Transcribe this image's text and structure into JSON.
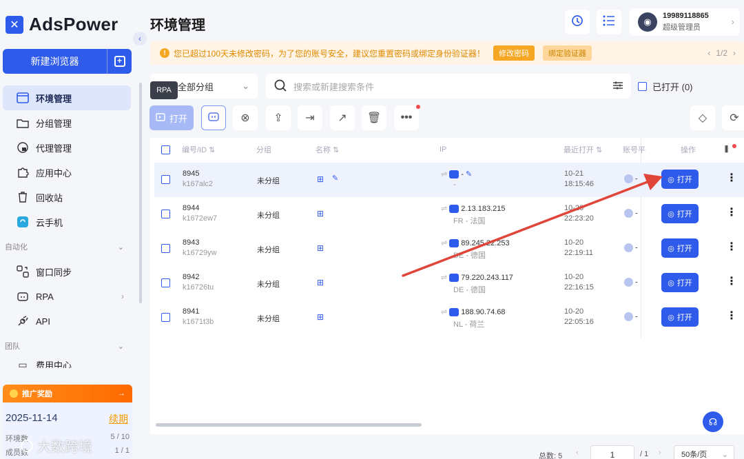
{
  "brand": {
    "name": "AdsPower"
  },
  "sidebar": {
    "new_browser": "新建浏览器",
    "items": [
      {
        "label": "环境管理",
        "icon": "browser-window-icon"
      },
      {
        "label": "分组管理",
        "icon": "folder-icon"
      },
      {
        "label": "代理管理",
        "icon": "globe-lock-icon"
      },
      {
        "label": "应用中心",
        "icon": "puzzle-icon"
      },
      {
        "label": "回收站",
        "icon": "trash-icon"
      },
      {
        "label": "云手机",
        "icon": "cloud-phone-icon"
      }
    ],
    "section_automation": "自动化",
    "automation_items": [
      {
        "label": "窗口同步",
        "icon": "window-sync-icon"
      },
      {
        "label": "RPA",
        "icon": "robot-icon"
      },
      {
        "label": "API",
        "icon": "api-plug-icon"
      }
    ],
    "section_team": "团队",
    "team_partial": "费用中心",
    "promo": {
      "title": "推广奖励",
      "date": "2025-11-14",
      "renew": "续期",
      "env_label": "环境数",
      "env_value": "5 / 10",
      "member_label": "成员数",
      "member_value": "1 / 1"
    }
  },
  "watermark": "大数跨境",
  "header": {
    "title": "环境管理",
    "user_phone": "19989118865",
    "user_role": "超级管理员"
  },
  "alert": {
    "text": "您已超过100天未修改密码，为了您的账号安全，建议您重置密码或绑定身份验证器！",
    "btn_change": "修改密码",
    "btn_bind": "绑定验证器",
    "pager": "1/2"
  },
  "filters": {
    "group_value": "全部分组",
    "tooltip": "RPA",
    "search_placeholder": "搜索或新建搜索条件",
    "opened_label": "已打开 (0)"
  },
  "toolbar": {
    "open_label": "打开"
  },
  "table": {
    "headers": {
      "id": "编号/ID",
      "group": "分组",
      "name": "名称",
      "ip": "IP",
      "last_open": "最近打开",
      "account": "账号平",
      "ops": "操作"
    },
    "open_label": "打开",
    "rows": [
      {
        "num": "8945",
        "id": "k167alc2",
        "group": "未分组",
        "ip": "-",
        "ip_loc": "-",
        "date": "10-21",
        "time": "18:15:46"
      },
      {
        "num": "8944",
        "id": "k1672ew7",
        "group": "未分组",
        "ip": "2.13.183.215",
        "ip_loc": "FR - 法国",
        "date": "10-20",
        "time": "22:23:20"
      },
      {
        "num": "8943",
        "id": "k16729yw",
        "group": "未分组",
        "ip": "89.245.22.253",
        "ip_loc": "DE - 德国",
        "date": "10-20",
        "time": "22:19:11"
      },
      {
        "num": "8942",
        "id": "k16726tu",
        "group": "未分组",
        "ip": "79.220.243.117",
        "ip_loc": "DE - 德国",
        "date": "10-20",
        "time": "22:16:15"
      },
      {
        "num": "8941",
        "id": "k1671t3b",
        "group": "未分组",
        "ip": "188.90.74.68",
        "ip_loc": "NL - 荷兰",
        "date": "10-20",
        "time": "22:05:16"
      }
    ]
  },
  "pagination": {
    "total": "总数: 5",
    "page": "1",
    "of": "/ 1",
    "page_size": "50条/页"
  },
  "colors": {
    "primary": "#2f5bea",
    "warning": "#f5a623",
    "arrow": "#e0453a"
  }
}
